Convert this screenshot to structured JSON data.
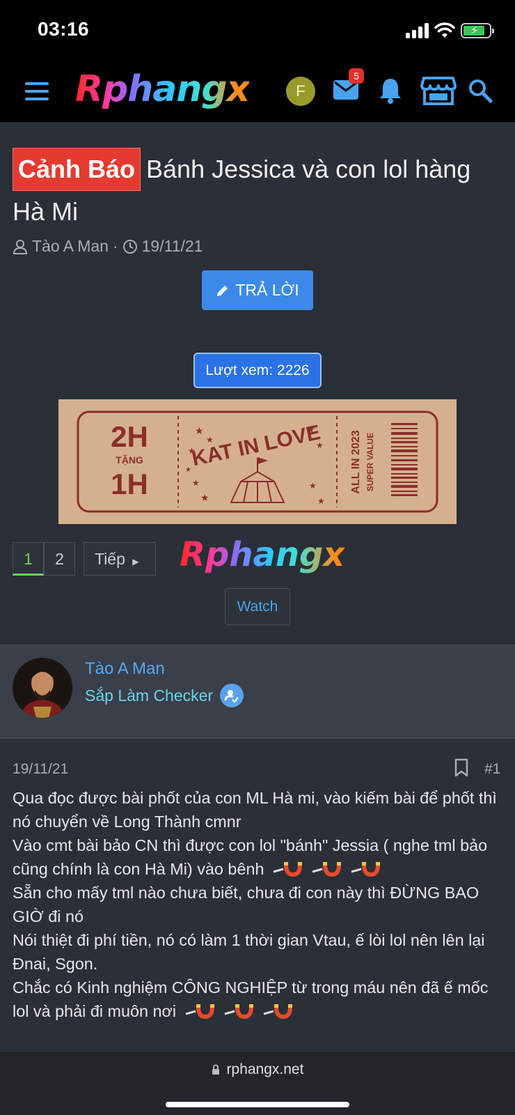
{
  "status_bar": {
    "time": "03:16"
  },
  "header": {
    "logo": "Rphangx",
    "user_initial": "F",
    "mail_badge": "5"
  },
  "thread": {
    "prefix": "Cảnh Báo",
    "title": "Bánh Jessica và con lol hàng Hà Mi",
    "author": "Tào A Man",
    "date": "19/11/21",
    "reply_label": "TRẢ LỜI",
    "views": "Lượt xem: 2226"
  },
  "banner": {
    "left_top": "2H",
    "left_mid": "TẶNG",
    "left_bottom": "1H",
    "center": "KAT IN LOVE",
    "right_1": "ALL IN 2023",
    "right_2": "SUPER VALUE"
  },
  "pagination": {
    "pages": [
      "1",
      "2"
    ],
    "active": "1",
    "next_label": "Tiếp",
    "logo": "Rphangx"
  },
  "watch_label": "Watch",
  "post": {
    "username": "Tào A Man",
    "user_title": "Sắp Làm Checker",
    "date": "19/11/21",
    "number": "#1",
    "paragraphs": [
      "Qua đọc được bài phốt của con ML Hà mi, vào kiếm bài để phốt thì nó chuyển về Long Thành cmnr",
      "Vào cmt bài bảo CN thì được con lol \"bánh\" Jessia ( nghe tml bảo cũng chính là con Hà Mi) vào bênh",
      "Sẵn cho mấy tml nào chưa biết, chưa đi con này thì ĐỪNG BAO GIỜ đi nó",
      "Nói thiệt đi phí tiền, nó có làm 1 thời gian Vtau, ế lòi lol nên lên lại Đnai, Sgon.",
      "Chắc có Kinh nghiệm CÔNG NGHIỆP từ trong máu nên đã ế mốc lol và phải đi muôn nơi"
    ]
  },
  "browser": {
    "url": "rphangx.net"
  }
}
